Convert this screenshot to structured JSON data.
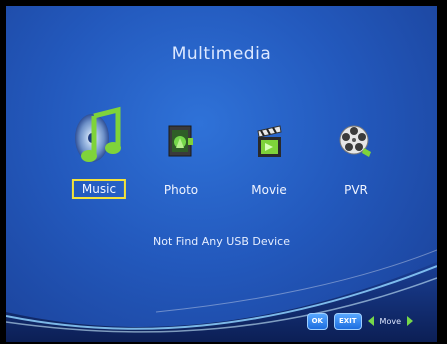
{
  "screen": {
    "title": "Multimedia"
  },
  "menu": {
    "selected": "Music",
    "items": [
      {
        "label": "Music",
        "icon": "music-note-disc-icon"
      },
      {
        "label": "Photo",
        "icon": "photo-icon"
      },
      {
        "label": "Movie",
        "icon": "movie-clapperboard-icon"
      },
      {
        "label": "PVR",
        "icon": "film-reel-icon"
      }
    ]
  },
  "status": {
    "message": "Not Find Any USB Device"
  },
  "footer": {
    "ok_label": "OK",
    "exit_label": "EXIT",
    "move_label": "Move"
  },
  "colors": {
    "background": "#2359bd",
    "selection_border": "#f3e33a",
    "icon_green": "#7fd33a"
  }
}
